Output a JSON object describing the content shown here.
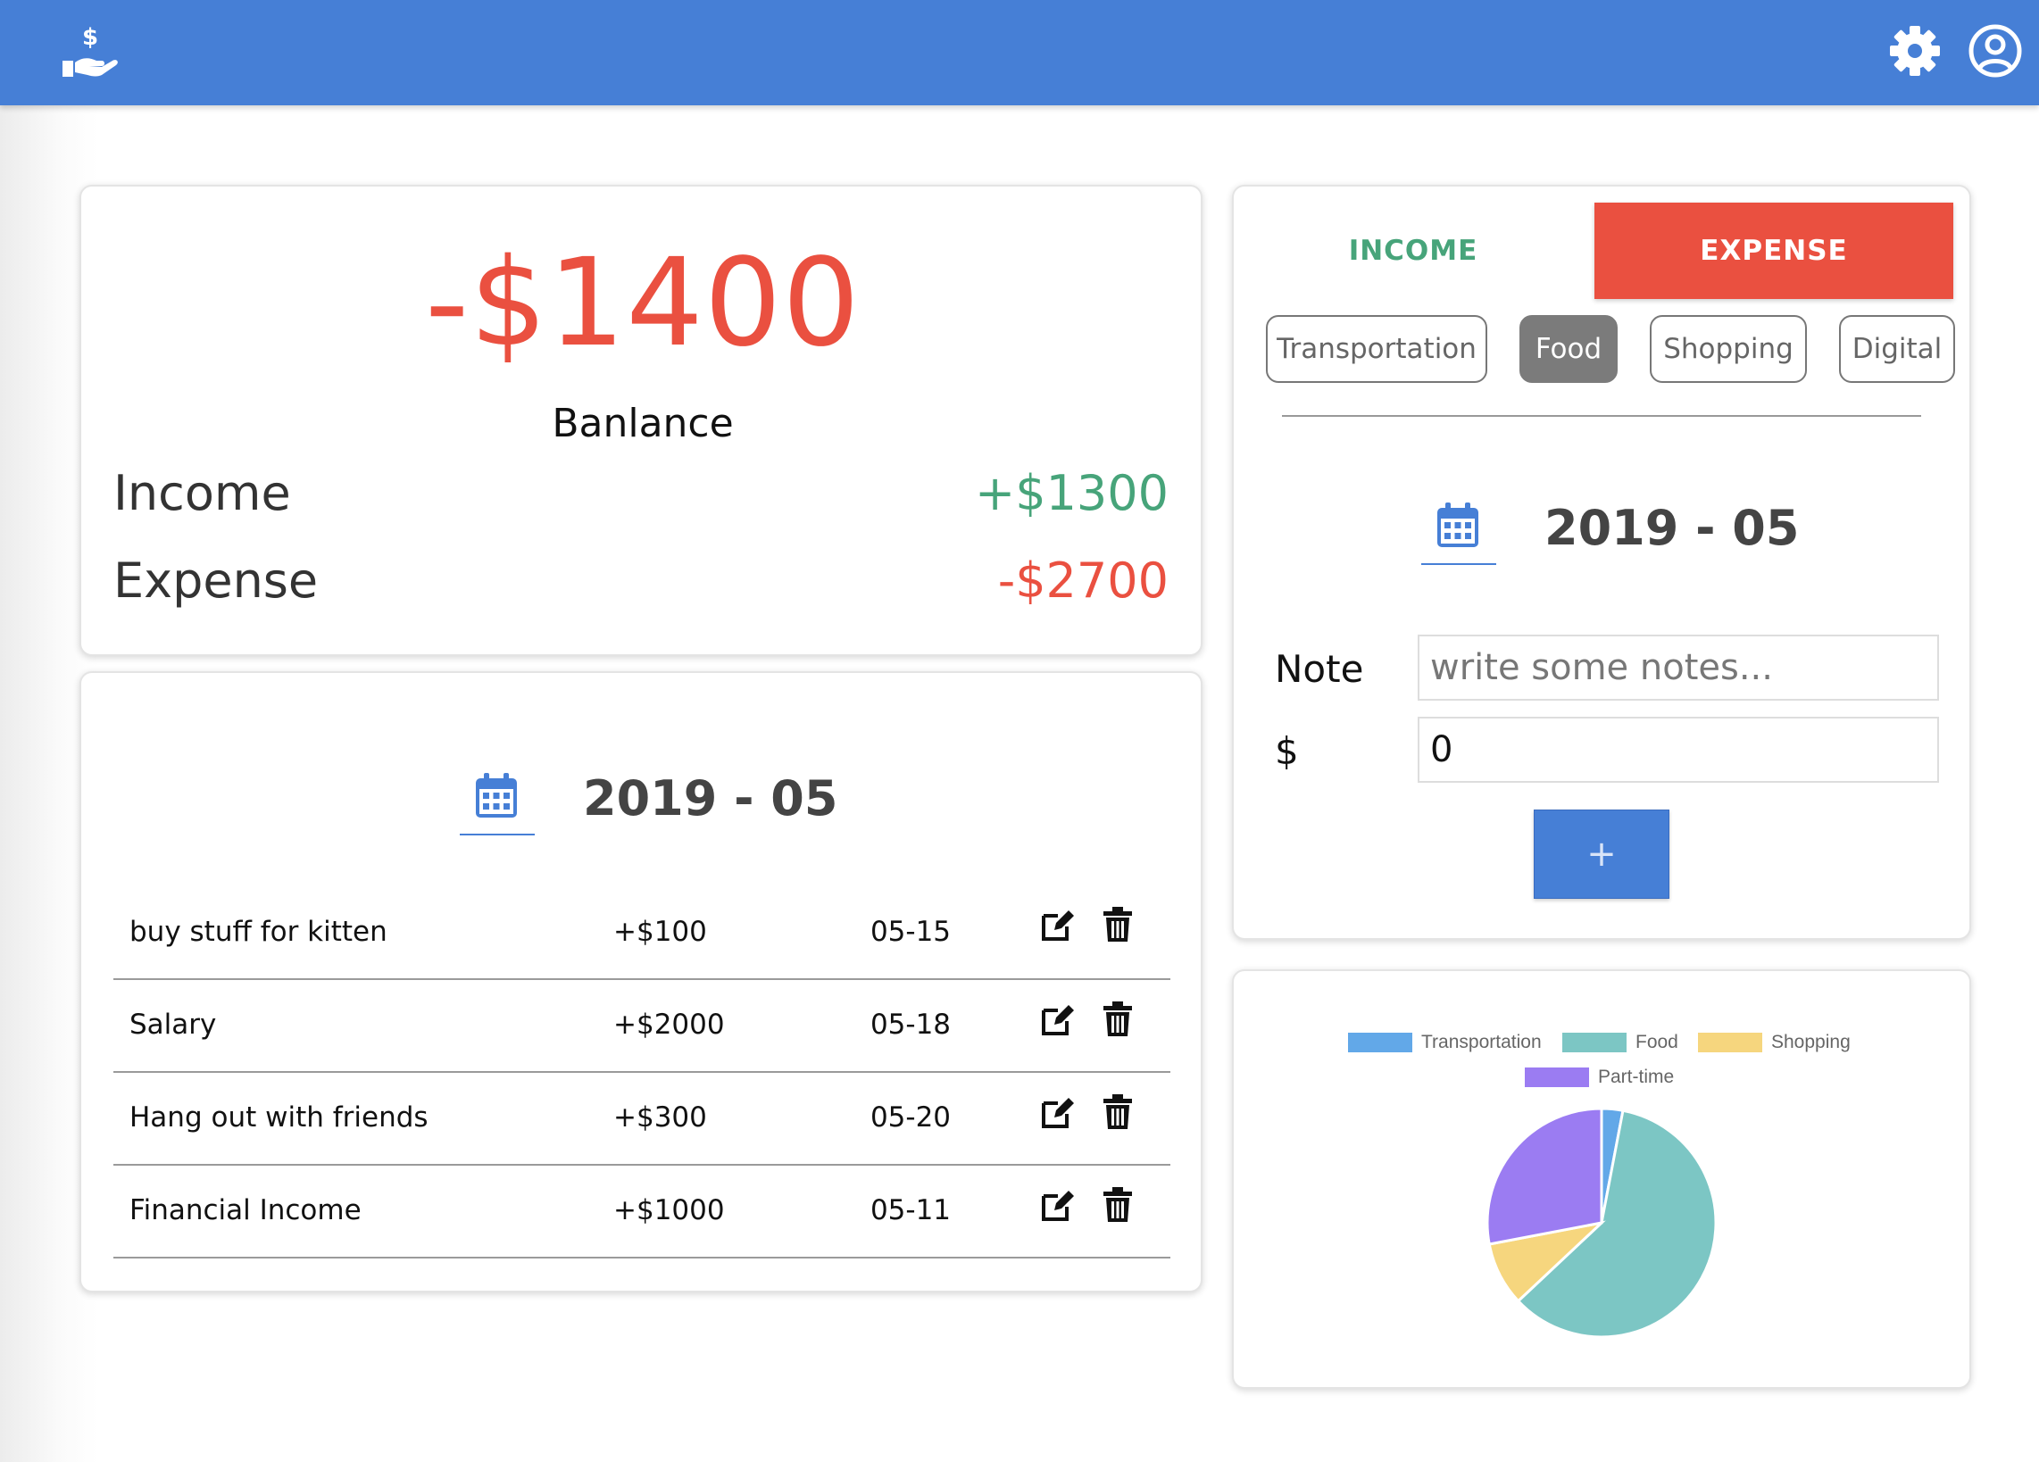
{
  "header": {
    "logo_icon": "hand-dollar-icon",
    "settings_icon": "gear-icon",
    "profile_icon": "user-circle-icon",
    "color": "#467fd6"
  },
  "summary": {
    "balance": "-$1400",
    "balance_label": "Banlance",
    "income_label": "Income",
    "income_value": "+$1300",
    "expense_label": "Expense",
    "expense_value": "-$2700"
  },
  "list": {
    "date": "2019 - 05",
    "rows": [
      {
        "note": "buy stuff for kitten",
        "amount": "+$100",
        "date": "05-15"
      },
      {
        "note": "Salary",
        "amount": "+$2000",
        "date": "05-18"
      },
      {
        "note": "Hang out with friends",
        "amount": "+$300",
        "date": "05-20"
      },
      {
        "note": "Financial Income",
        "amount": "+$1000",
        "date": "05-11"
      }
    ]
  },
  "entry": {
    "tabs": {
      "income": "INCOME",
      "expense": "EXPENSE",
      "active": "expense"
    },
    "categories": [
      "Transportation",
      "Food",
      "Shopping",
      "Digital"
    ],
    "active_category": "Food",
    "date": "2019 - 05",
    "note_label": "Note",
    "note_placeholder": "write some notes...",
    "amount_label": "$",
    "amount_value": "0",
    "add_label": "+"
  },
  "chart_data": {
    "type": "pie",
    "legend": [
      "Transportation",
      "Food",
      "Shopping",
      "Part-time"
    ],
    "colors": [
      "#62a8e8",
      "#7cc6c4",
      "#f6d67e",
      "#9b7cf2"
    ],
    "values": [
      3,
      60,
      9,
      28
    ],
    "legend_position": "top"
  }
}
